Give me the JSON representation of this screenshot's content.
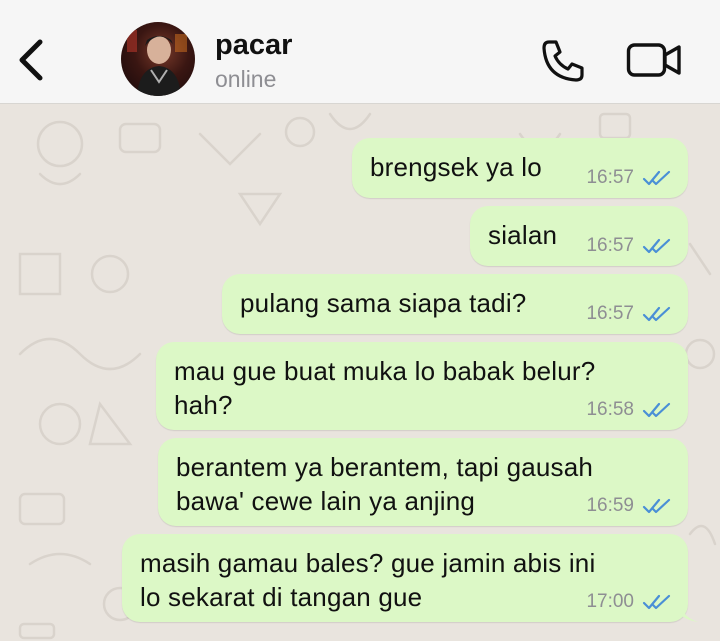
{
  "header": {
    "contact_name": "pacar",
    "contact_status": "online",
    "back_icon": "chevron-left-icon",
    "call_icon": "phone-icon",
    "video_icon": "video-camera-icon"
  },
  "colors": {
    "outgoing_bubble": "#dcf8c6",
    "read_ticks": "#4a8fd6",
    "chat_background": "#e9e4de"
  },
  "messages": [
    {
      "lines": [
        "brengsek ya lo"
      ],
      "time": "16:57",
      "status": "read"
    },
    {
      "lines": [
        "sialan"
      ],
      "time": "16:57",
      "status": "read"
    },
    {
      "lines": [
        "pulang sama siapa tadi?"
      ],
      "time": "16:57",
      "status": "read"
    },
    {
      "lines": [
        "mau gue buat muka lo babak belur?",
        "hah?"
      ],
      "time": "16:58",
      "status": "read"
    },
    {
      "lines": [
        "berantem ya berantem, tapi gausah",
        "bawa' cewe lain ya anjing"
      ],
      "time": "16:59",
      "status": "read"
    },
    {
      "lines": [
        "masih gamau bales? gue jamin abis ini",
        "lo sekarat di tangan gue"
      ],
      "time": "17:00",
      "status": "read"
    }
  ]
}
